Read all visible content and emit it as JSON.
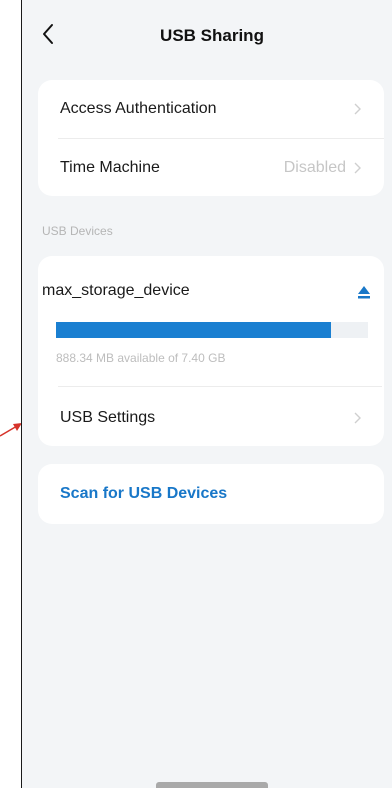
{
  "header": {
    "title": "USB Sharing"
  },
  "settings": {
    "access_authentication": "Access Authentication",
    "time_machine": "Time Machine",
    "time_machine_value": "Disabled"
  },
  "usb_devices": {
    "section_label": "USB Devices",
    "device_name": "max_storage_device",
    "storage_text": "888.34 MB available of 7.40 GB",
    "used_fraction": 0.88,
    "usb_settings": "USB Settings"
  },
  "scan": {
    "label": "Scan for USB Devices"
  },
  "colors": {
    "accent": "#1877c8",
    "progress": "#1a7fd1",
    "background": "#f3f5f7",
    "annotation": "#d6332a"
  },
  "icons": {
    "back": "chevron-left-icon",
    "chevron": "chevron-right-icon",
    "eject": "eject-icon"
  }
}
